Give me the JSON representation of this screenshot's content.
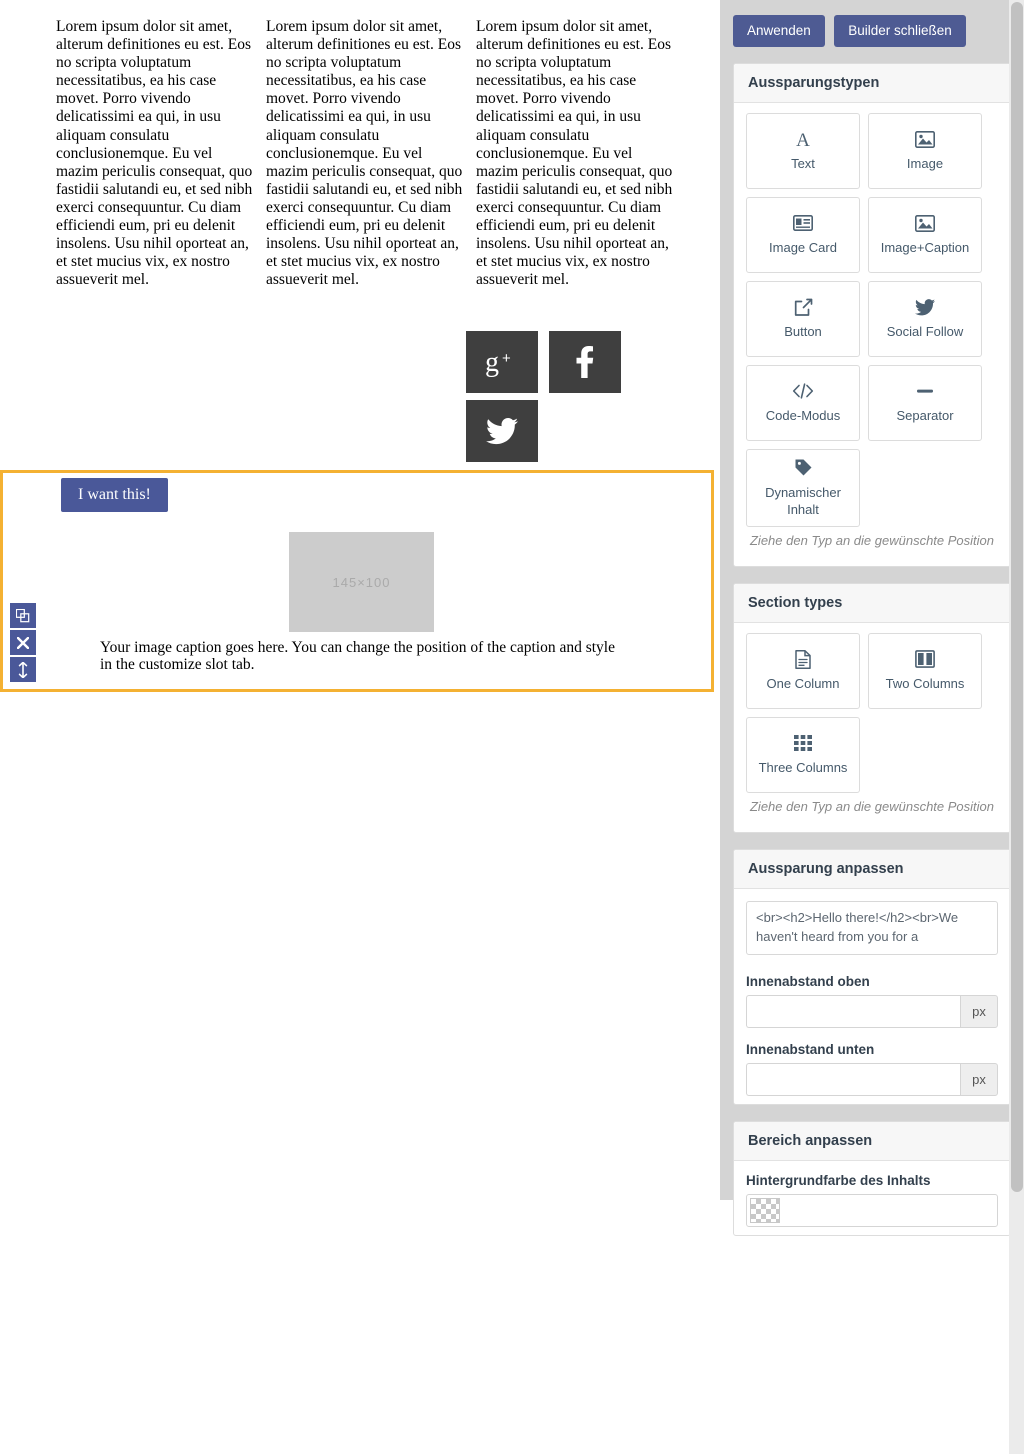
{
  "canvas": {
    "columns": [
      {
        "text": "Lorem ipsum dolor sit amet, alterum definitiones eu est. Eos no scripta voluptatum necessitatibus, ea his case movet. Porro vivendo delicatissimi ea qui, in usu aliquam consulatu conclusionemque. Eu vel mazim periculis consequat, quo fastidii salutandi eu, et sed nibh exerci consequuntur. Cu diam efficiendi eum, pri eu delenit insolens. Usu nihil oporteat an, et stet mucius vix, ex nostro assueverit mel."
      },
      {
        "text": "Lorem ipsum dolor sit amet, alterum definitiones eu est. Eos no scripta voluptatum necessitatibus, ea his case movet. Porro vivendo delicatissimi ea qui, in usu aliquam consulatu conclusionemque. Eu vel mazim periculis consequat, quo fastidii salutandi eu, et sed nibh exerci consequuntur. Cu diam efficiendi eum, pri eu delenit insolens. Usu nihil oporteat an, et stet mucius vix, ex nostro assueverit mel."
      },
      {
        "text": "Lorem ipsum dolor sit amet, alterum definitiones eu est. Eos no scripta voluptatum necessitatibus, ea his case movet. Porro vivendo delicatissimi ea qui, in usu aliquam consulatu conclusionemque. Eu vel mazim periculis consequat, quo fastidii salutandi eu, et sed nibh exerci consequuntur. Cu diam efficiendi eum, pri eu delenit insolens. Usu nihil oporteat an, et stet mucius vix, ex nostro assueverit mel."
      }
    ],
    "social": [
      {
        "icon": "google-plus-icon",
        "name": "Google Plus"
      },
      {
        "icon": "facebook-icon",
        "name": "Facebook"
      },
      {
        "icon": "twitter-icon",
        "name": "Twitter"
      }
    ],
    "selected_section": {
      "cta_label": "I want this!",
      "image_placeholder": "145×100",
      "caption": "Your image caption goes here. You can change the position of the caption and style in the customize slot tab.",
      "border_color": "#f4b132",
      "controls": [
        {
          "icon": "copy-icon",
          "name": "duplicate-section"
        },
        {
          "icon": "close-icon",
          "name": "delete-section"
        },
        {
          "icon": "move-vertical-icon",
          "name": "move-section"
        }
      ]
    }
  },
  "panel": {
    "accent_color": "#4e5b93",
    "background_color": "#d4d4d4",
    "buttons": {
      "apply": "Anwenden",
      "close_builder": "Builder schließen"
    },
    "slot_types": {
      "title": "Aussparungstypen",
      "hint": "Ziehe den Typ an die gewünschte Position",
      "tiles": [
        {
          "label": "Text",
          "icon": "text-icon"
        },
        {
          "label": "Image",
          "icon": "image-icon"
        },
        {
          "label": "Image Card",
          "icon": "image-card-icon"
        },
        {
          "label": "Image+Caption",
          "icon": "image-caption-icon"
        },
        {
          "label": "Button",
          "icon": "external-link-icon"
        },
        {
          "label": "Social Follow",
          "icon": "twitter-icon"
        },
        {
          "label": "Code-Modus",
          "icon": "code-icon"
        },
        {
          "label": "Separator",
          "icon": "separator-icon"
        },
        {
          "label": "Dynamischer Inhalt",
          "icon": "tag-icon"
        }
      ]
    },
    "section_types": {
      "title": "Section types",
      "hint": "Ziehe den Typ an die gewünschte Position",
      "tiles": [
        {
          "label": "One Column",
          "icon": "one-column-icon"
        },
        {
          "label": "Two Columns",
          "icon": "two-columns-icon"
        },
        {
          "label": "Three Columns",
          "icon": "three-columns-icon"
        }
      ]
    },
    "customize_slot": {
      "title": "Aussparung anpassen",
      "code_value": "<br><h2>Hello there!</h2><br>We haven't heard from you for a",
      "padding_top_label": "Innenabstand oben",
      "padding_top_value": "",
      "padding_bottom_label": "Innenabstand unten",
      "padding_bottom_value": "",
      "unit": "px"
    },
    "customize_area": {
      "title": "Bereich anpassen",
      "bg_label": "Hintergrundfarbe des Inhalts",
      "bg_value": ""
    }
  }
}
